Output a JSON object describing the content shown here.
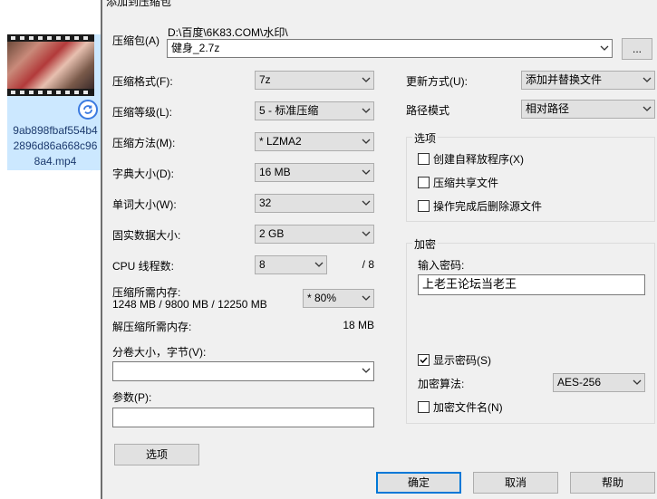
{
  "desktop": {
    "file_name": "9ab898fbaf554b42896d86a668c968a4.mp4"
  },
  "dialog": {
    "title": "添加到压缩包",
    "archive_label": "压缩包(A)",
    "archive_path": "D:\\百度\\6K83.COM\\水印\\",
    "archive_name": "健身_2.7z",
    "browse_label": "...",
    "format_label": "压缩格式(F):",
    "format_value": "7z",
    "level_label": "压缩等级(L):",
    "level_value": "5 - 标准压缩",
    "method_label": "压缩方法(M):",
    "method_value": "*  LZMA2",
    "dict_label": "字典大小(D):",
    "dict_value": "16 MB",
    "word_label": "单词大小(W):",
    "word_value": "32",
    "solid_label": "固实数据大小:",
    "solid_value": "2 GB",
    "cpu_label": "CPU 线程数:",
    "cpu_value": "8",
    "cpu_total": "/ 8",
    "mem_label": "压缩所需内存:",
    "mem_detail": "1248 MB / 9800 MB / 12250 MB",
    "mem_value": "* 80%",
    "decomp_label": "解压缩所需内存:",
    "decomp_value": "18 MB",
    "volume_label": "分卷大小，字节(V):",
    "volume_value": "",
    "params_label": "参数(P):",
    "params_value": "",
    "options_button": "选项",
    "update_label": "更新方式(U):",
    "update_value": "添加并替换文件",
    "path_label": "路径模式",
    "path_value": "相对路径",
    "options_group": "选项",
    "opt_sfx": "创建自释放程序(X)",
    "opt_shared": "压缩共享文件",
    "opt_delete": "操作完成后删除源文件",
    "encrypt_group": "加密",
    "password_label": "输入密码:",
    "password_value": "上老王论坛当老王",
    "show_password": "显示密码(S)",
    "algo_label": "加密算法:",
    "algo_value": "AES-256",
    "encrypt_names": "加密文件名(N)",
    "ok": "确定",
    "cancel": "取消",
    "help": "帮助"
  }
}
